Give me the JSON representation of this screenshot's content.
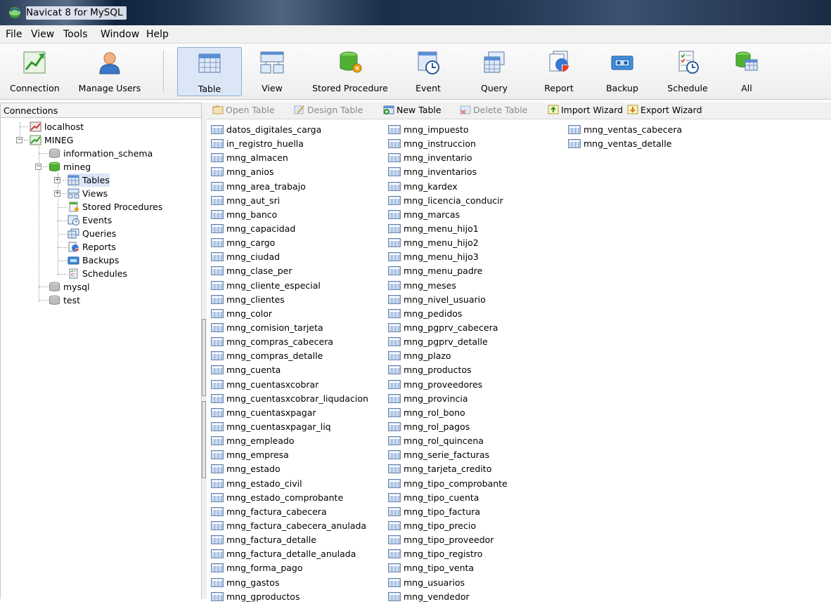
{
  "window": {
    "title": "Navicat 8 for MySQL"
  },
  "menu": [
    "File",
    "View",
    "Tools",
    "Window",
    "Help"
  ],
  "toolbar": {
    "connection": "Connection",
    "manage_users": "Manage Users",
    "table": "Table",
    "view": "View",
    "stored_procedure": "Stored Procedure",
    "event": "Event",
    "query": "Query",
    "report": "Report",
    "backup": "Backup",
    "schedule": "Schedule",
    "all": "All"
  },
  "connections": {
    "header": "Connections",
    "localhost": "localhost",
    "mineg_conn": "MINEG",
    "information_schema": "information_schema",
    "mineg_db": "mineg",
    "tables": "Tables",
    "views": "Views",
    "stored_procedures": "Stored Procedures",
    "events": "Events",
    "queries": "Queries",
    "reports": "Reports",
    "backups": "Backups",
    "schedules": "Schedules",
    "mysql": "mysql",
    "test": "test"
  },
  "object_toolbar": {
    "open_table": "Open Table",
    "design_table": "Design Table",
    "new_table": "New Table",
    "delete_table": "Delete Table",
    "import_wizard": "Import Wizard",
    "export_wizard": "Export Wizard"
  },
  "tables": {
    "col1": [
      "datos_digitales_carga",
      "in_registro_huella",
      "mng_almacen",
      "mng_anios",
      "mng_area_trabajo",
      "mng_aut_sri",
      "mng_banco",
      "mng_capacidad",
      "mng_cargo",
      "mng_ciudad",
      "mng_clase_per",
      "mng_cliente_especial",
      "mng_clientes",
      "mng_color",
      "mng_comision_tarjeta",
      "mng_compras_cabecera",
      "mng_compras_detalle",
      "mng_cuenta",
      "mng_cuentasxcobrar",
      "mng_cuentasxcobrar_liqudacion",
      "mng_cuentasxpagar",
      "mng_cuentasxpagar_liq",
      "mng_empleado",
      "mng_empresa",
      "mng_estado",
      "mng_estado_civil",
      "mng_estado_comprobante",
      "mng_factura_cabecera",
      "mng_factura_cabecera_anulada",
      "mng_factura_detalle",
      "mng_factura_detalle_anulada",
      "mng_forma_pago",
      "mng_gastos",
      "mng_gproductos"
    ],
    "col2": [
      "mng_impuesto",
      "mng_instruccion",
      "mng_inventario",
      "mng_inventarios",
      "mng_kardex",
      "mng_licencia_conducir",
      "mng_marcas",
      "mng_menu_hijo1",
      "mng_menu_hijo2",
      "mng_menu_hijo3",
      "mng_menu_padre",
      "mng_meses",
      "mng_nivel_usuario",
      "mng_pedidos",
      "mng_pgprv_cabecera",
      "mng_pgprv_detalle",
      "mng_plazo",
      "mng_productos",
      "mng_proveedores",
      "mng_provincia",
      "mng_rol_bono",
      "mng_rol_pagos",
      "mng_rol_quincena",
      "mng_serie_facturas",
      "mng_tarjeta_credito",
      "mng_tipo_comprobante",
      "mng_tipo_cuenta",
      "mng_tipo_factura",
      "mng_tipo_precio",
      "mng_tipo_proveedor",
      "mng_tipo_registro",
      "mng_tipo_venta",
      "mng_usuarios",
      "mng_vendedor"
    ],
    "col3": [
      "mng_ventas_cabecera",
      "mng_ventas_detalle"
    ]
  }
}
